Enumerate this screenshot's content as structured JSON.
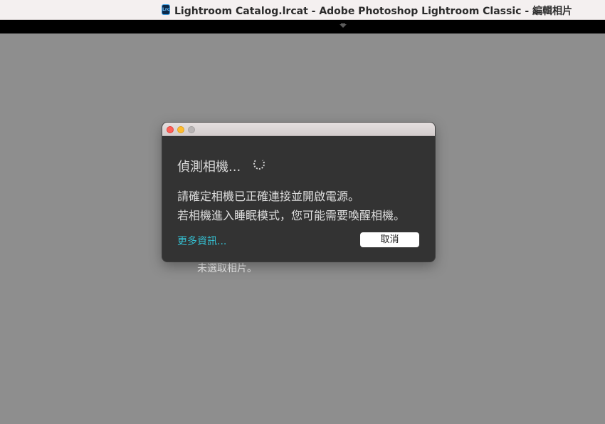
{
  "window": {
    "app_icon": "Lrc",
    "title": "Lightroom Catalog.lrcat - Adobe Photoshop Lightroom Classic - 編輯相片"
  },
  "main": {
    "empty_message": "未選取相片。"
  },
  "dialog": {
    "heading": "偵測相機...",
    "line1": "請確定相機已正確連接並開啟電源。",
    "line2": "若相機進入睡眠模式，您可能需要喚醒相機。",
    "more_info_link": "更多資訊...",
    "cancel_label": "取消"
  },
  "colors": {
    "canvas": "#8e8e8e",
    "dialog_bg": "#333333",
    "link": "#35c0d2",
    "close_light": "#fe5f57",
    "minimize_light": "#febc2e"
  },
  "icons": [
    "lightroom-app-icon",
    "panel-grip-icon",
    "loading-spinner-icon"
  ]
}
